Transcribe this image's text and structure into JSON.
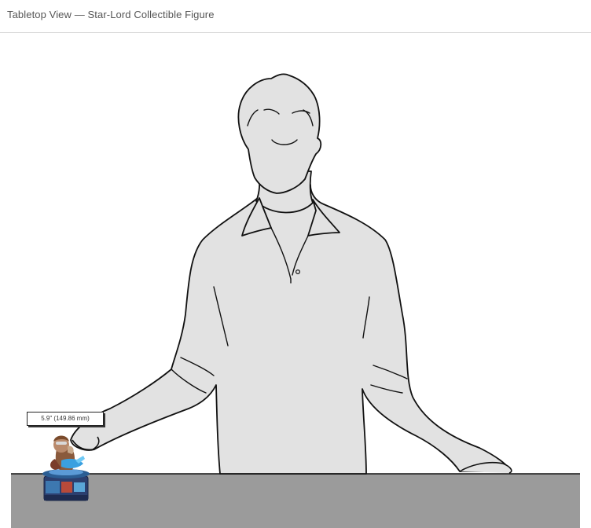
{
  "header": {
    "title": "Tabletop View — Star-Lord Collectible Figure"
  },
  "scene": {
    "silhouette_icon": "person-silhouette-icon",
    "table_color": "#9b9b9b",
    "silhouette_fill": "#e2e2e2",
    "figure_icon": "star-lord-figure-icon"
  },
  "measurement": {
    "label": "5.9\" (149.86 mm)"
  }
}
